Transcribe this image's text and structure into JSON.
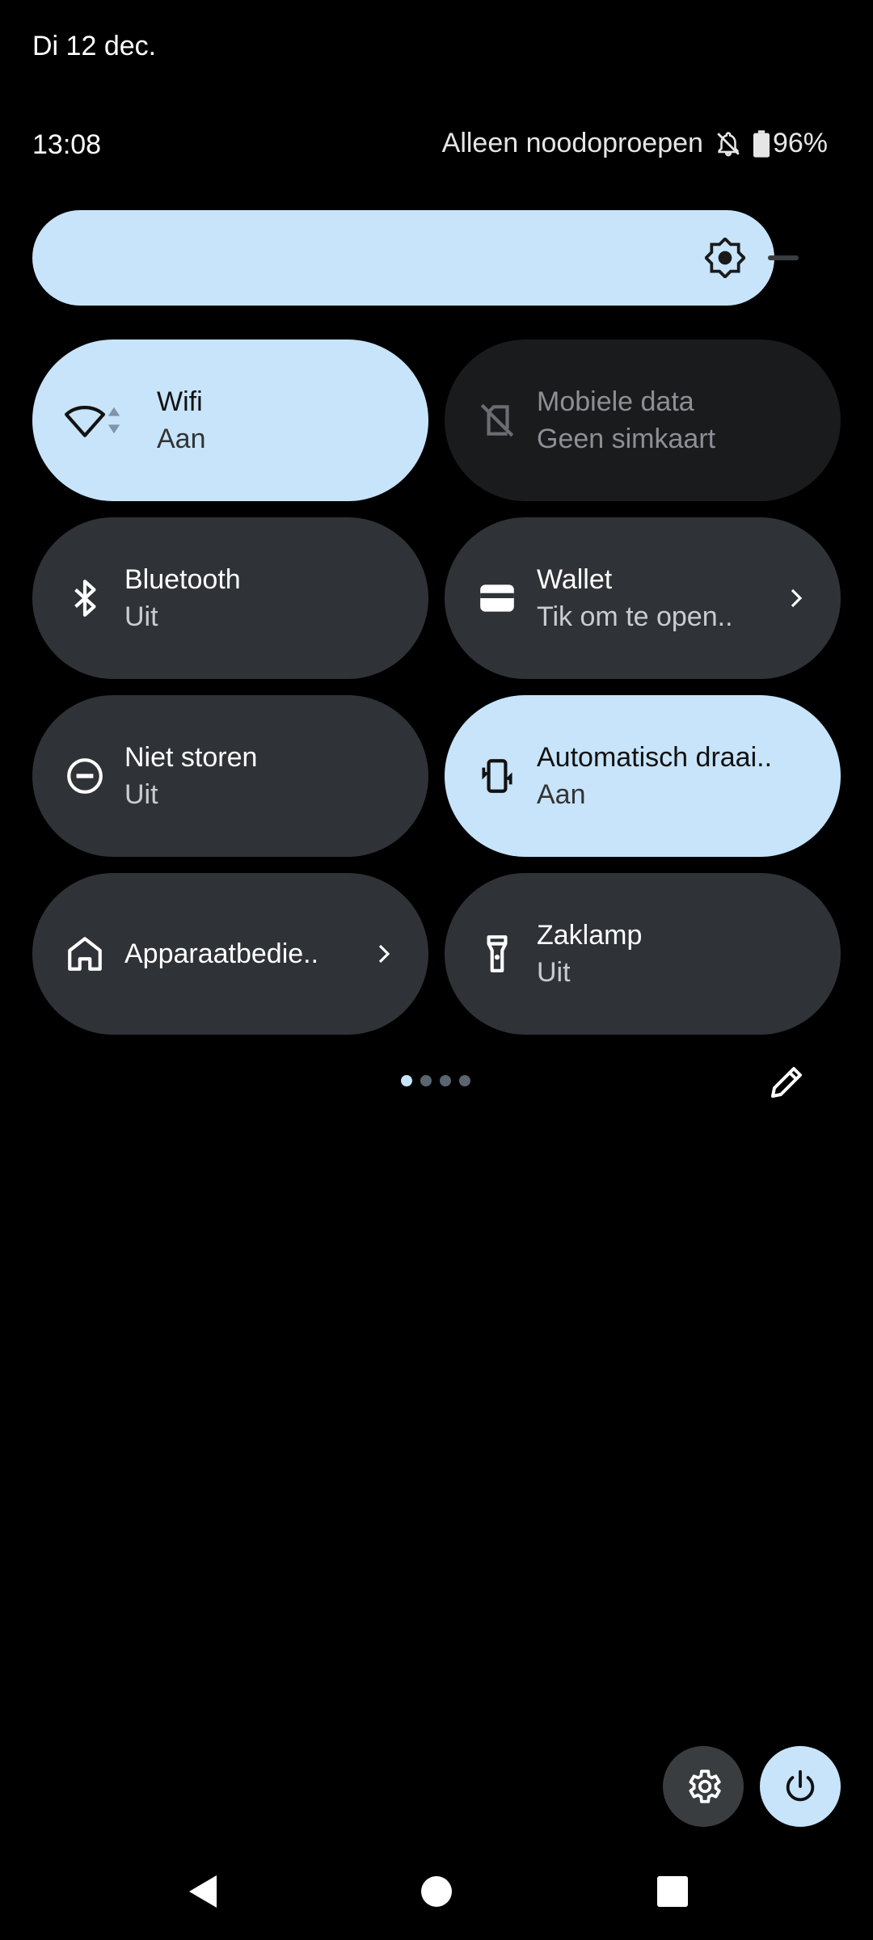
{
  "header": {
    "date": "Di 12 dec.",
    "time": "13:08",
    "status_text": "Alleen noodoproepen",
    "battery": "96%"
  },
  "brightness": {
    "level": 0.96,
    "icon": "brightness-icon"
  },
  "tiles": [
    {
      "label": "Wifi",
      "sub": "Aan",
      "state": "active",
      "icon": "wifi-icon"
    },
    {
      "label": "Mobiele data",
      "sub": "Geen simkaart",
      "state": "unavailable",
      "icon": "no-sim-icon"
    },
    {
      "label": "Bluetooth",
      "sub": "Uit",
      "state": "off",
      "icon": "bluetooth-icon"
    },
    {
      "label": "Wallet",
      "sub": "Tik om te open..",
      "state": "off",
      "icon": "wallet-icon"
    },
    {
      "label": "Niet storen",
      "sub": "Uit",
      "state": "off",
      "icon": "do-not-disturb-icon"
    },
    {
      "label": "Automatisch draai..",
      "sub": "Aan",
      "state": "active",
      "icon": "auto-rotate-icon"
    },
    {
      "label": "Apparaatbedie..",
      "sub": "",
      "state": "off",
      "icon": "home-icon"
    },
    {
      "label": "Zaklamp",
      "sub": "Uit",
      "state": "off",
      "icon": "flashlight-icon"
    }
  ],
  "pager": {
    "pages": 4,
    "current": 1
  },
  "colors": {
    "active": "#c7e4fb",
    "tile": "#2f3236",
    "background": "#000000"
  }
}
